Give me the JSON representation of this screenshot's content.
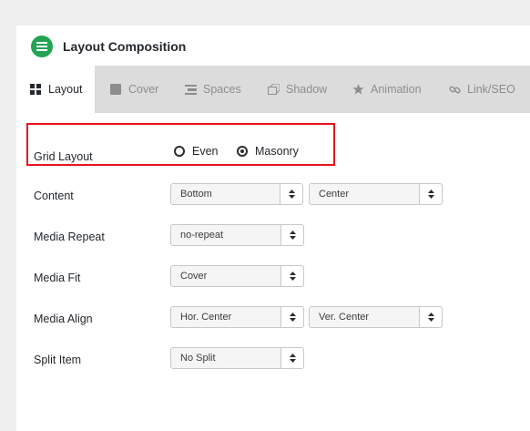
{
  "header": {
    "title": "Layout Composition",
    "icon": "menu-lines-icon",
    "icon_color": "#23a455"
  },
  "tabs": [
    {
      "label": "Layout",
      "icon": "grid-icon",
      "active": true
    },
    {
      "label": "Cover",
      "icon": "square-icon",
      "active": false
    },
    {
      "label": "Spaces",
      "icon": "spacing-icon",
      "active": false
    },
    {
      "label": "Shadow",
      "icon": "shadow-icon",
      "active": false
    },
    {
      "label": "Animation",
      "icon": "star-icon",
      "active": false
    },
    {
      "label": "Link/SEO",
      "icon": "link-icon",
      "active": false
    }
  ],
  "grid_layout": {
    "label": "Grid Layout",
    "options": [
      {
        "label": "Even",
        "checked": false
      },
      {
        "label": "Masonry",
        "checked": true
      }
    ],
    "highlight_color": "#e8141c"
  },
  "content": {
    "label": "Content",
    "value1": "Bottom",
    "value2": "Center"
  },
  "media_repeat": {
    "label": "Media Repeat",
    "value": "no-repeat"
  },
  "media_fit": {
    "label": "Media Fit",
    "value": "Cover"
  },
  "media_align": {
    "label": "Media Align",
    "value1": "Hor. Center",
    "value2": "Ver. Center"
  },
  "split_item": {
    "label": "Split Item",
    "value": "No Split"
  }
}
